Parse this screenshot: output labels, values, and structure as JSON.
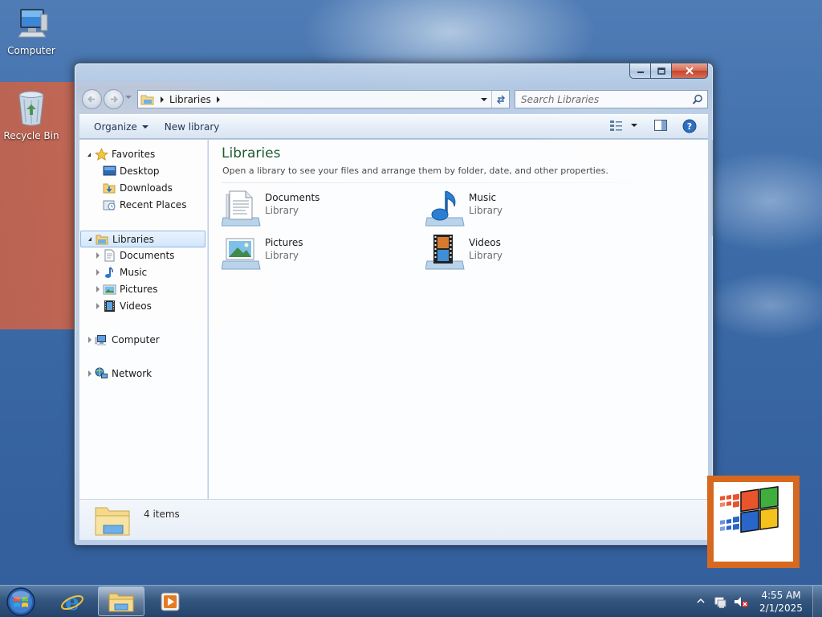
{
  "desktop": {
    "icons": [
      {
        "label": "Computer",
        "icon": "computer-icon"
      },
      {
        "label": "Recycle Bin",
        "icon": "recycle-bin-icon"
      }
    ]
  },
  "window": {
    "address": {
      "crumbs": [
        "Libraries"
      ]
    },
    "search": {
      "placeholder": "Search Libraries"
    },
    "command_bar": {
      "organize_label": "Organize",
      "new_library_label": "New library"
    },
    "nav_pane": {
      "favorites": {
        "label": "Favorites",
        "items": [
          "Desktop",
          "Downloads",
          "Recent Places"
        ]
      },
      "libraries": {
        "label": "Libraries",
        "items": [
          "Documents",
          "Music",
          "Pictures",
          "Videos"
        ]
      },
      "computer": {
        "label": "Computer"
      },
      "network": {
        "label": "Network"
      }
    },
    "content": {
      "title": "Libraries",
      "description": "Open a library to see your files and arrange them by folder, date, and other properties.",
      "libraries": [
        {
          "name": "Documents",
          "type": "Library",
          "icon": "documents-library-icon"
        },
        {
          "name": "Music",
          "type": "Library",
          "icon": "music-library-icon"
        },
        {
          "name": "Pictures",
          "type": "Library",
          "icon": "pictures-library-icon"
        },
        {
          "name": "Videos",
          "type": "Library",
          "icon": "videos-library-icon"
        }
      ]
    },
    "details": {
      "count": "4 items"
    }
  },
  "taskbar": {
    "clock": {
      "time": "4:55 AM",
      "date": "2/1/2025"
    },
    "pinned": [
      "start-orb",
      "internet-explorer-icon",
      "windows-explorer-icon",
      "media-player-icon"
    ]
  },
  "colors": {
    "title_green": "#1e5c30",
    "desktop_blue": "#3b6aa6",
    "selection": "#d3e6fb",
    "badge_orange": "#d6691f"
  }
}
